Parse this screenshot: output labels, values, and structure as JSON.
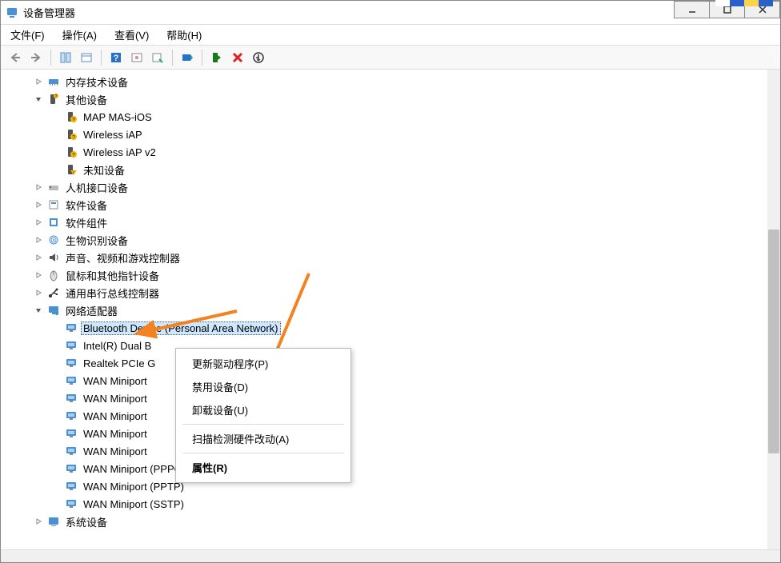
{
  "window": {
    "title": "设备管理器"
  },
  "menubar": [
    "文件(F)",
    "操作(A)",
    "查看(V)",
    "帮助(H)"
  ],
  "tree": [
    {
      "depth": 1,
      "exp": "closed",
      "icon": "mem",
      "label": "内存技术设备"
    },
    {
      "depth": 1,
      "exp": "open",
      "icon": "other",
      "label": "其他设备"
    },
    {
      "depth": 2,
      "exp": "none",
      "icon": "warn",
      "label": "MAP MAS-iOS"
    },
    {
      "depth": 2,
      "exp": "none",
      "icon": "warn",
      "label": "Wireless iAP"
    },
    {
      "depth": 2,
      "exp": "none",
      "icon": "warn",
      "label": "Wireless iAP v2"
    },
    {
      "depth": 2,
      "exp": "none",
      "icon": "warn2",
      "label": "未知设备"
    },
    {
      "depth": 1,
      "exp": "closed",
      "icon": "hid",
      "label": "人机接口设备"
    },
    {
      "depth": 1,
      "exp": "closed",
      "icon": "soft",
      "label": "软件设备"
    },
    {
      "depth": 1,
      "exp": "closed",
      "icon": "comp",
      "label": "软件组件"
    },
    {
      "depth": 1,
      "exp": "closed",
      "icon": "bio",
      "label": "生物识别设备"
    },
    {
      "depth": 1,
      "exp": "closed",
      "icon": "audio",
      "label": "声音、视频和游戏控制器"
    },
    {
      "depth": 1,
      "exp": "closed",
      "icon": "mouse",
      "label": "鼠标和其他指针设备"
    },
    {
      "depth": 1,
      "exp": "closed",
      "icon": "usb",
      "label": "通用串行总线控制器"
    },
    {
      "depth": 1,
      "exp": "open",
      "icon": "net",
      "label": "网络适配器"
    },
    {
      "depth": 2,
      "exp": "none",
      "icon": "netdev",
      "label": "Bluetooth Device (Personal Area Network)",
      "selected": true
    },
    {
      "depth": 2,
      "exp": "none",
      "icon": "netdev",
      "label": "Intel(R) Dual B"
    },
    {
      "depth": 2,
      "exp": "none",
      "icon": "netdev",
      "label": "Realtek PCIe G"
    },
    {
      "depth": 2,
      "exp": "none",
      "icon": "netdev",
      "label": "WAN Miniport"
    },
    {
      "depth": 2,
      "exp": "none",
      "icon": "netdev",
      "label": "WAN Miniport"
    },
    {
      "depth": 2,
      "exp": "none",
      "icon": "netdev",
      "label": "WAN Miniport"
    },
    {
      "depth": 2,
      "exp": "none",
      "icon": "netdev",
      "label": "WAN Miniport"
    },
    {
      "depth": 2,
      "exp": "none",
      "icon": "netdev",
      "label": "WAN Miniport"
    },
    {
      "depth": 2,
      "exp": "none",
      "icon": "netdev",
      "label": "WAN Miniport (PPPOE)"
    },
    {
      "depth": 2,
      "exp": "none",
      "icon": "netdev",
      "label": "WAN Miniport (PPTP)"
    },
    {
      "depth": 2,
      "exp": "none",
      "icon": "netdev",
      "label": "WAN Miniport (SSTP)"
    },
    {
      "depth": 1,
      "exp": "closed",
      "icon": "sys",
      "label": "系统设备"
    }
  ],
  "context_menu": {
    "items": [
      {
        "label": "更新驱动程序(P)",
        "type": "item"
      },
      {
        "label": "禁用设备(D)",
        "type": "item"
      },
      {
        "label": "卸载设备(U)",
        "type": "item"
      },
      {
        "type": "sep"
      },
      {
        "label": "扫描检测硬件改动(A)",
        "type": "item"
      },
      {
        "type": "sep"
      },
      {
        "label": "属性(R)",
        "type": "item",
        "bold": true
      }
    ]
  }
}
